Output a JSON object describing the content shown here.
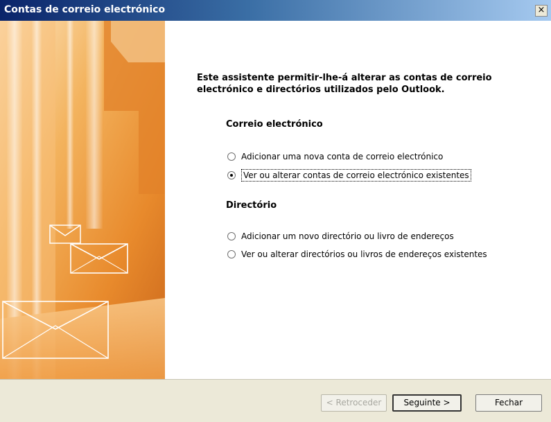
{
  "window": {
    "title": "Contas de correio electrónico",
    "close_label": "×"
  },
  "content": {
    "intro": "Este assistente permitir-lhe-á alterar as contas de correio electrónico e directórios utilizados pelo Outlook.",
    "email_section": {
      "title": "Correio electrónico",
      "options": [
        {
          "label": "Adicionar uma nova conta de correio electrónico",
          "checked": false
        },
        {
          "label": "Ver ou alterar contas de correio electrónico existentes",
          "checked": true
        }
      ]
    },
    "directory_section": {
      "title": "Directório",
      "options": [
        {
          "label": "Adicionar um novo directório ou livro de endereços",
          "checked": false
        },
        {
          "label": "Ver ou alterar directórios ou livros de endereços existentes",
          "checked": false
        }
      ]
    }
  },
  "buttons": {
    "back": "< Retroceder",
    "next": "Seguinte >",
    "close": "Fechar"
  },
  "colors": {
    "titlebar": "#0a246a",
    "art_orange": "#e08a2a",
    "button_bar": "#ece9d8"
  },
  "icons": [
    "envelope-icon",
    "close-icon"
  ]
}
